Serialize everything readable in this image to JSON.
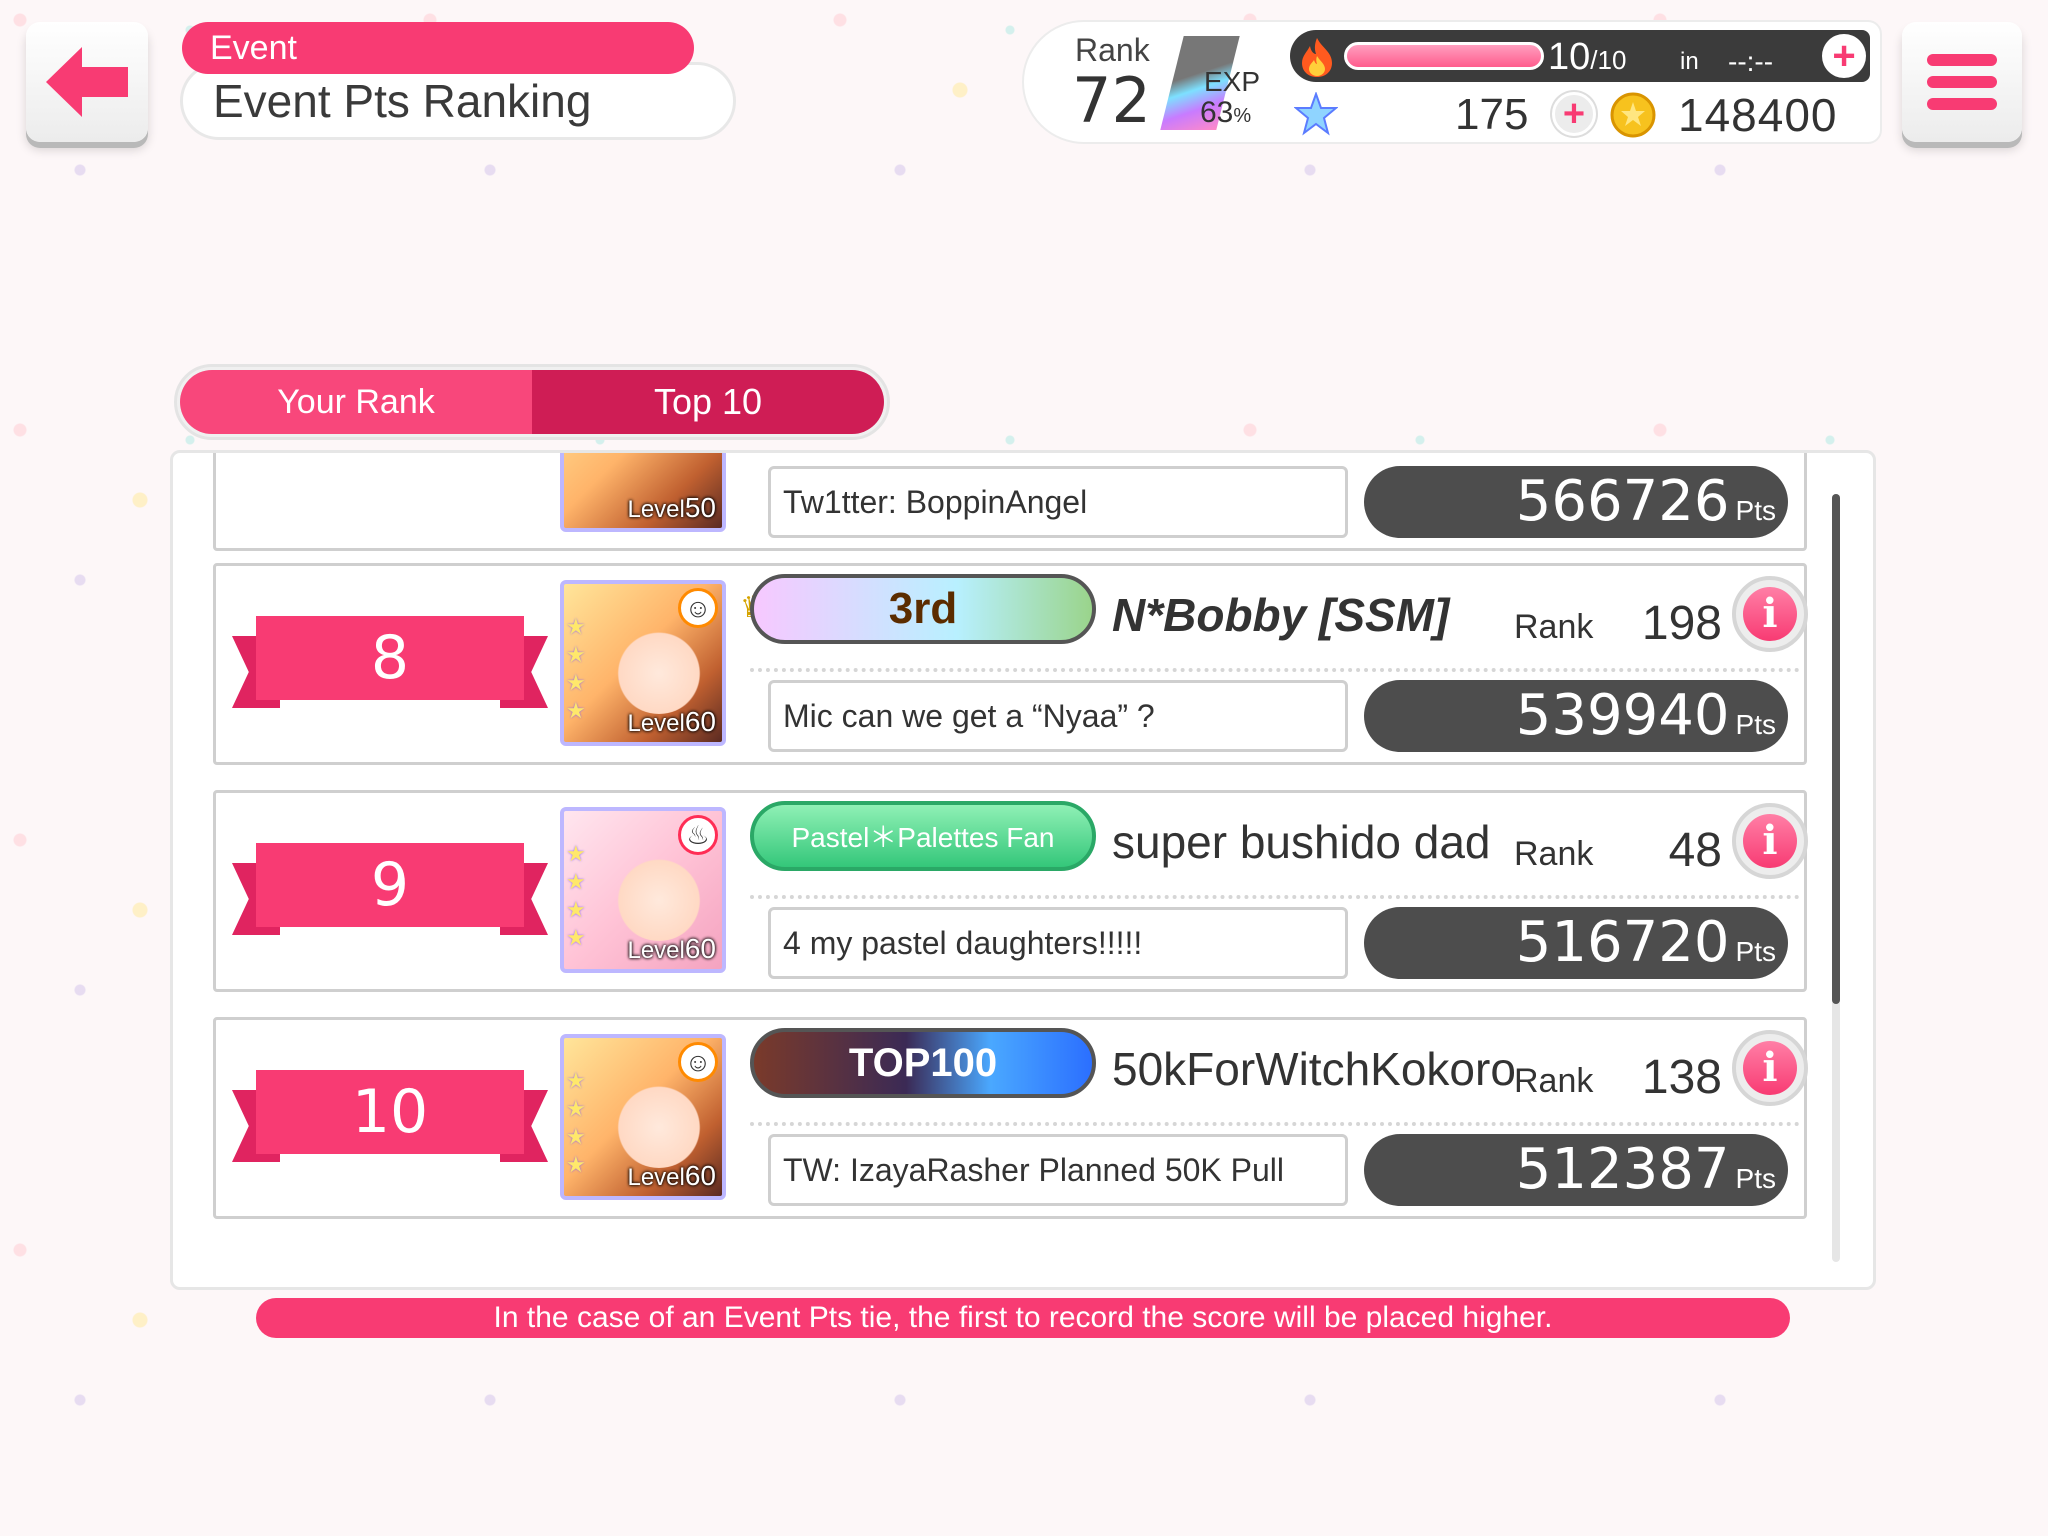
{
  "header": {
    "event_label": "Event",
    "title": "Event Pts Ranking"
  },
  "status": {
    "rank_label": "Rank",
    "rank_value": "72",
    "exp_label": "EXP",
    "exp_percent": "63",
    "exp_percent_sign": "%",
    "stamina_current": "10",
    "stamina_max": "/10",
    "stamina_in": "in",
    "stamina_timer": "--:--",
    "stars": "175",
    "coins": "148400"
  },
  "tabs": {
    "your_rank": "Your Rank",
    "top10": "Top 10"
  },
  "rows": {
    "partial": {
      "card_level_prefix": "Level",
      "card_level": "50",
      "comment": "Tw1tter: BoppinAngel",
      "points": "566726",
      "pts_suffix": "Pts"
    },
    "r8": {
      "rank": "8",
      "card_level_prefix": "Level",
      "card_level": "60",
      "badge_text": "3rd",
      "name": "N*Bobby [SSM]",
      "rank_label": "Rank",
      "player_rank": "198",
      "comment": "Mic can we get a “Nyaa” ?",
      "points": "539940",
      "pts_suffix": "Pts"
    },
    "r9": {
      "rank": "9",
      "card_level_prefix": "Level",
      "card_level": "60",
      "badge_text": "Pastel＊Palettes Fan",
      "name": "super bushido dad",
      "rank_label": "Rank",
      "player_rank": "48",
      "comment": "4 my pastel daughters!!!!!",
      "points": "516720",
      "pts_suffix": "Pts"
    },
    "r10": {
      "rank": "10",
      "card_level_prefix": "Level",
      "card_level": "60",
      "badge_text": "TOP100",
      "name": "50kForWitchKokoro",
      "rank_label": "Rank",
      "player_rank": "138",
      "comment": "TW: IzayaRasher Planned 50K Pull",
      "points": "512387",
      "pts_suffix": "Pts"
    }
  },
  "footer": {
    "note": "In the case of an Event Pts tie, the first to record the score will be placed higher."
  },
  "colors": {
    "accent": "#f83b73",
    "accent_dark": "#cf1d55",
    "pts_bg": "#4d4d4d"
  },
  "icons": [
    "back-arrow-icon",
    "menu-icon",
    "fire-icon",
    "star-icon",
    "coin-icon",
    "plus-icon",
    "info-icon",
    "crown-icon"
  ]
}
